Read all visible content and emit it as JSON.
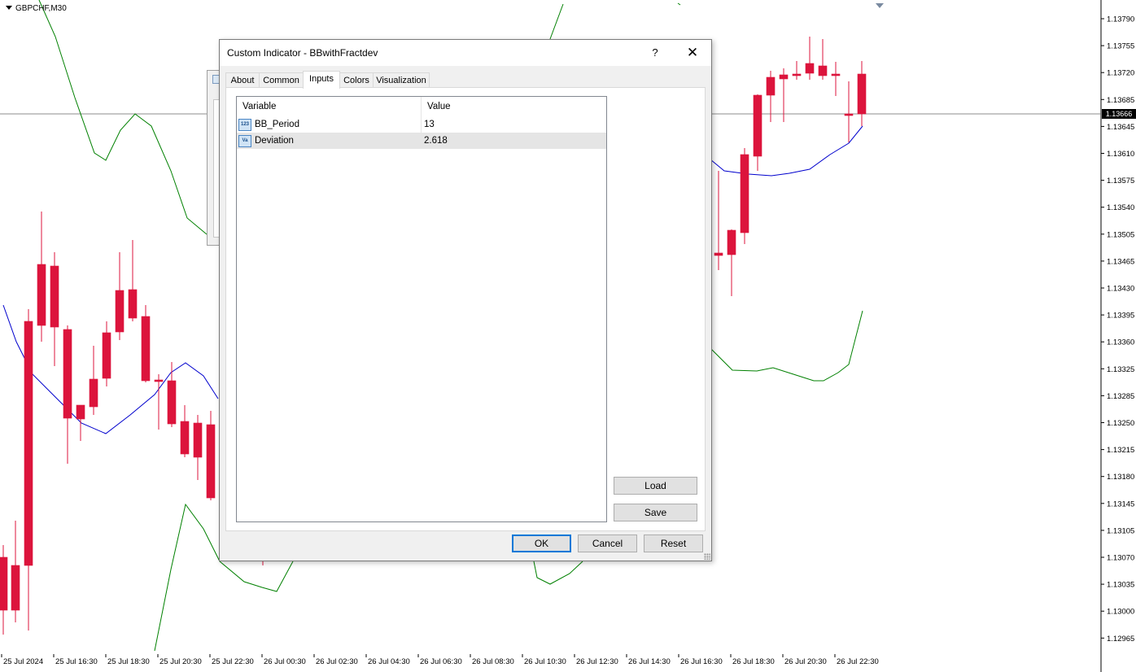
{
  "chart": {
    "symbol": "GBPCHF,M30",
    "current_price": "1.13666",
    "price_labels": [
      "1.13790",
      "1.13755",
      "1.13720",
      "1.13685",
      "1.13645",
      "1.13610",
      "1.13575",
      "1.13540",
      "1.13505",
      "1.13465",
      "1.13430",
      "1.13395",
      "1.13360",
      "1.13325",
      "1.13285",
      "1.13250",
      "1.13215",
      "1.13180",
      "1.13145",
      "1.13105",
      "1.13070",
      "1.13035",
      "1.13000",
      "1.12965"
    ],
    "time_labels": [
      "25 Jul 2024",
      "25 Jul 16:30",
      "25 Jul 18:30",
      "25 Jul 20:30",
      "25 Jul 22:30",
      "26 Jul 00:30",
      "26 Jul 02:30",
      "26 Jul 04:30",
      "26 Jul 06:30",
      "26 Jul 08:30",
      "26 Jul 10:30",
      "26 Jul 12:30",
      "26 Jul 14:30",
      "26 Jul 16:30",
      "26 Jul 18:30",
      "26 Jul 20:30",
      "26 Jul 22:30"
    ],
    "colors": {
      "bull": "#3cb371",
      "bear": "#dc143c",
      "middle_band": "#0000cd",
      "outer_band": "#008000",
      "grid": "#000000"
    }
  },
  "dialog": {
    "title": "Custom Indicator - BBwithFractdev",
    "help": "?",
    "close": "✕",
    "tabs": [
      {
        "label": "About"
      },
      {
        "label": "Common"
      },
      {
        "label": "Inputs"
      },
      {
        "label": "Colors"
      },
      {
        "label": "Visualization"
      }
    ],
    "active_tab": "Inputs",
    "table": {
      "headers": [
        "Variable",
        "Value"
      ],
      "rows": [
        {
          "icon": "123",
          "name": "BB_Period",
          "value": "13"
        },
        {
          "icon": "Va",
          "name": "Deviation",
          "value": "2.618"
        }
      ]
    },
    "load_label": "Load",
    "save_label": "Save",
    "ok_label": "OK",
    "cancel_label": "Cancel",
    "reset_label": "Reset"
  }
}
